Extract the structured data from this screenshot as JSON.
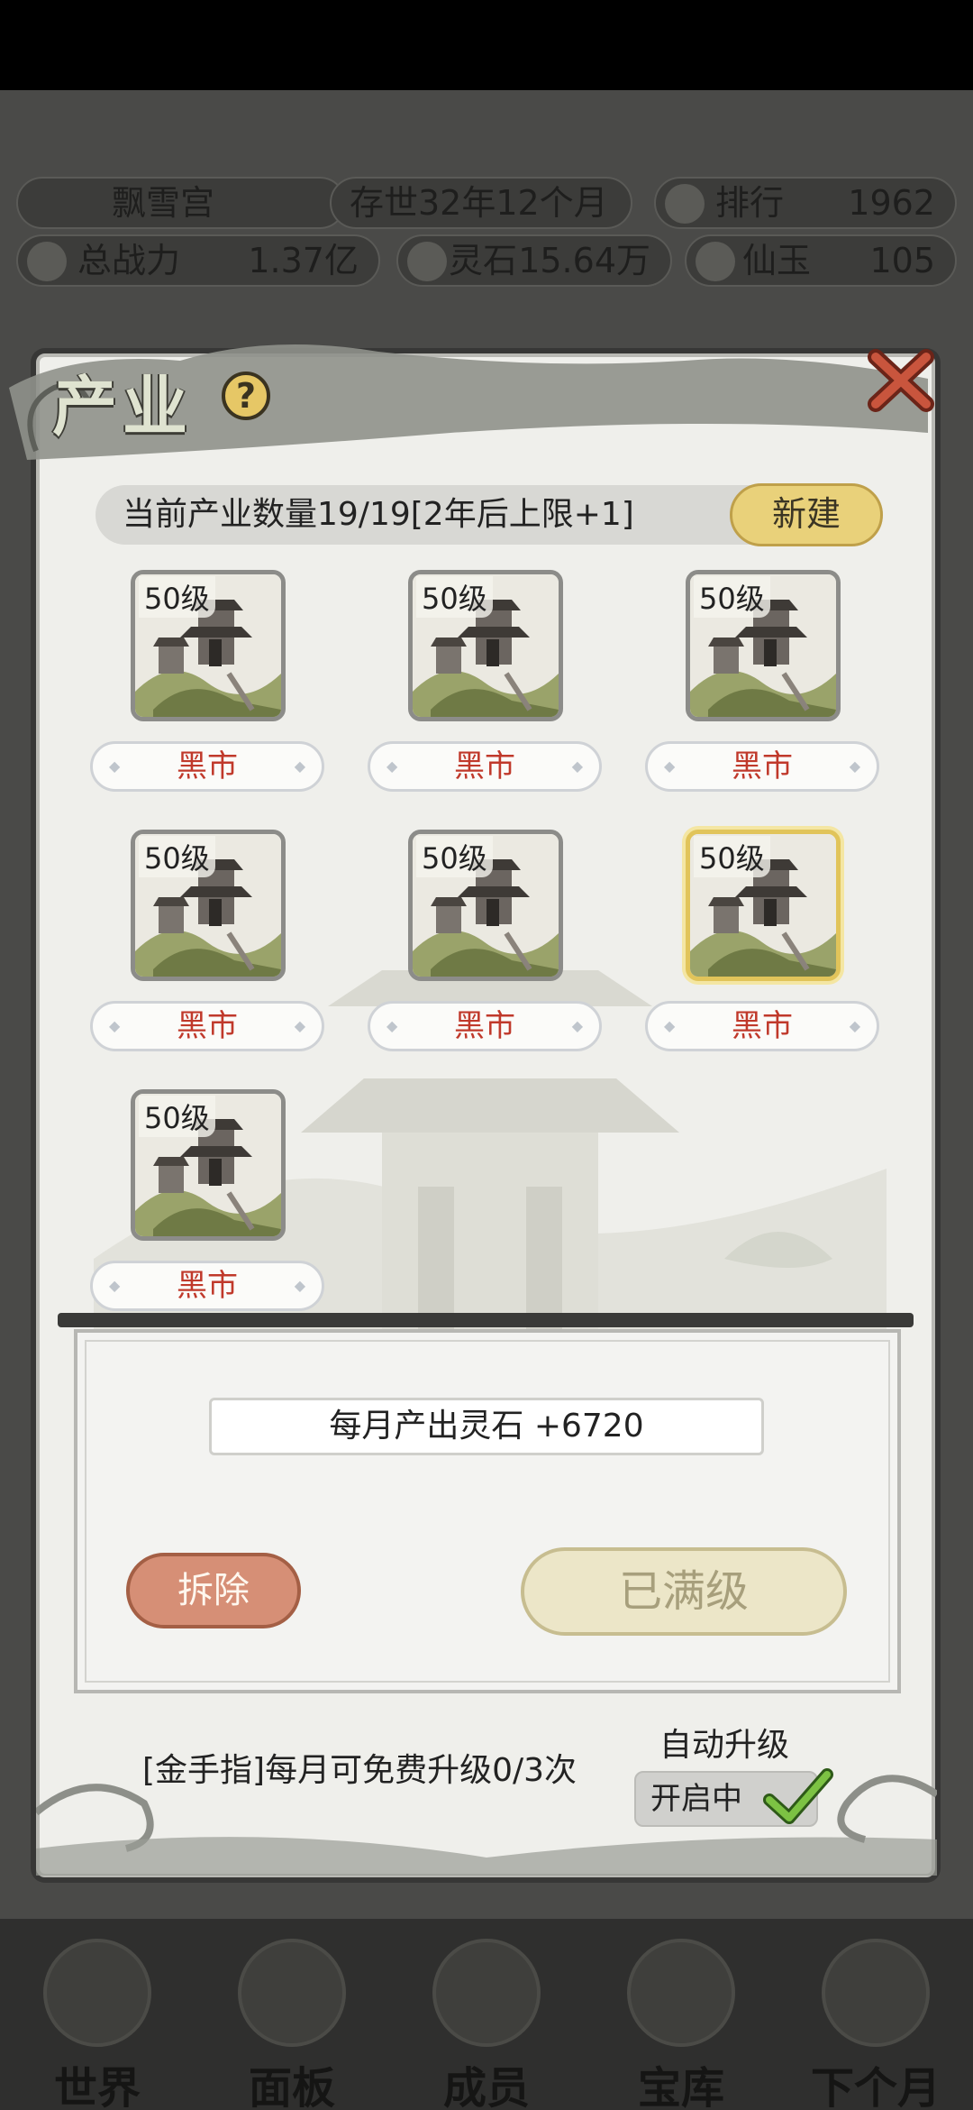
{
  "top_info": {
    "sect_name": "飘雪宫",
    "age": "存世32年12个月",
    "rank_label": "排行",
    "rank_value": "1962",
    "power_label": "总战力",
    "power_value": "1.37亿",
    "stone_label": "灵石",
    "stone_value": "15.64万",
    "jade_label": "仙玉",
    "jade_value": "105"
  },
  "modal": {
    "title": "产业",
    "help_icon": "?",
    "count_text": "当前产业数量19/19[2年后上限+1]",
    "new_button": "新建",
    "slots": [
      {
        "level": "50级",
        "name": "黑市",
        "selected": false
      },
      {
        "level": "50级",
        "name": "黑市",
        "selected": false
      },
      {
        "level": "50级",
        "name": "黑市",
        "selected": false
      },
      {
        "level": "50级",
        "name": "黑市",
        "selected": false
      },
      {
        "level": "50级",
        "name": "黑市",
        "selected": false
      },
      {
        "level": "50级",
        "name": "黑市",
        "selected": true
      },
      {
        "level": "50级",
        "name": "黑市",
        "selected": false
      }
    ],
    "detail": {
      "output": "每月产出灵石 +6720",
      "remove_button": "拆除",
      "maxed_button": "已满级"
    },
    "free_upgrade_text": "[金手指]每月可免费升级0/3次",
    "auto_upgrade_label": "自动升级",
    "auto_upgrade_state": "开启中",
    "auto_upgrade_on": true
  },
  "nav": [
    {
      "label": "世界"
    },
    {
      "label": "面板"
    },
    {
      "label": "成员"
    },
    {
      "label": "宝库"
    },
    {
      "label": "下个月"
    }
  ],
  "colors": {
    "accent_gold": "#e6c766",
    "name_red": "#c0392b",
    "remove_btn": "#d68f76",
    "check_green": "#6fb23a"
  }
}
